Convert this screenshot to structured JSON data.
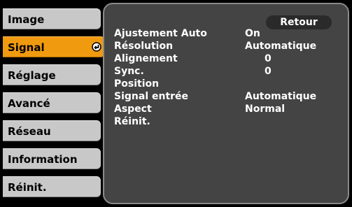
{
  "sidebar": {
    "items": [
      {
        "label": "Image"
      },
      {
        "label": "Signal"
      },
      {
        "label": "Réglage"
      },
      {
        "label": "Avancé"
      },
      {
        "label": "Réseau"
      },
      {
        "label": "Information"
      },
      {
        "label": "Réinit."
      }
    ],
    "selected": "Signal"
  },
  "panel": {
    "back_label": "Retour",
    "rows": [
      {
        "label": "Ajustement Auto",
        "value": "On"
      },
      {
        "label": "Résolution",
        "value": "Automatique"
      },
      {
        "label": "Alignement",
        "value": "0"
      },
      {
        "label": "Sync.",
        "value": "0"
      },
      {
        "label": "Position",
        "value": ""
      },
      {
        "label": "Signal entrée",
        "value": "Automatique"
      },
      {
        "label": "Aspect",
        "value": "Normal"
      },
      {
        "label": "Réinit.",
        "value": ""
      }
    ]
  },
  "colors": {
    "selected_tab": "#f09a10",
    "tab": "#c8c8c8",
    "panel": "#444444"
  }
}
